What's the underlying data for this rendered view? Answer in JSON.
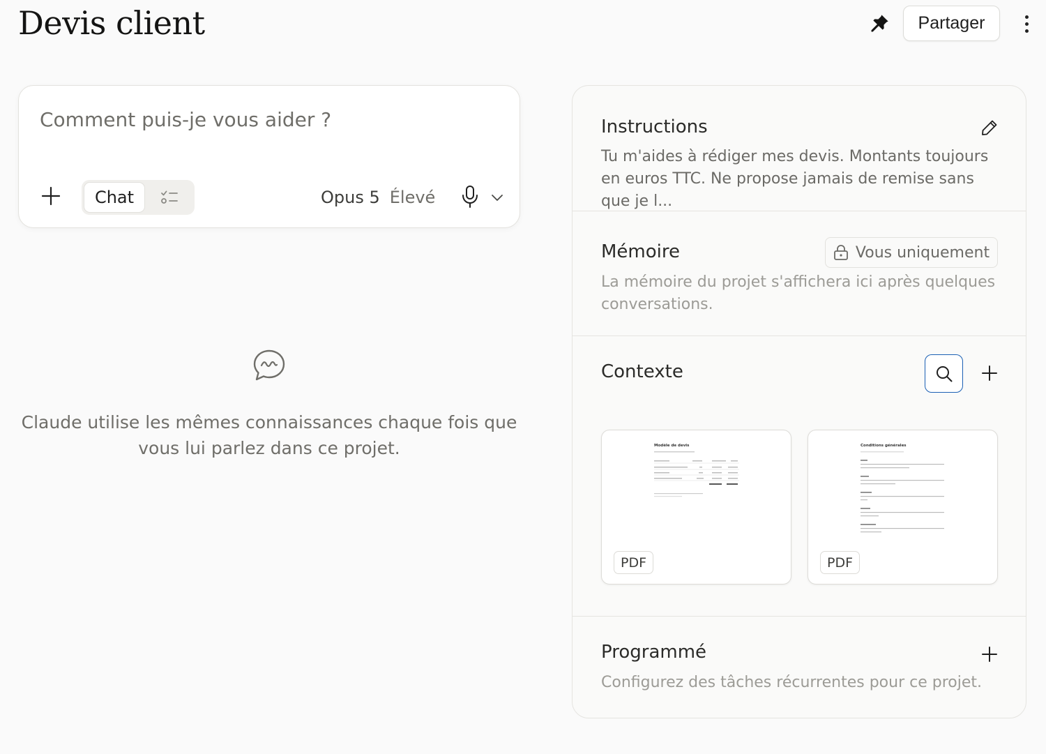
{
  "header": {
    "title": "Devis client",
    "share_label": "Partager"
  },
  "composer": {
    "placeholder": "Comment puis-je vous aider ?",
    "mode_chat_label": "Chat",
    "model_name": "Opus 5",
    "model_effort": "Élevé"
  },
  "empty_state": {
    "text": "Claude utilise les mêmes connaissances chaque fois que vous lui parlez dans ce projet."
  },
  "panel": {
    "instructions": {
      "title": "Instructions",
      "text": "Tu m'aides à rédiger mes devis. Montants toujours en euros TTC. Ne propose jamais de remise sans que je l..."
    },
    "memory": {
      "title": "Mémoire",
      "badge": "Vous uniquement",
      "text": "La mémoire du projet s'affichera ici après quelques conversations."
    },
    "context": {
      "title": "Contexte",
      "files": [
        {
          "type": "PDF",
          "doc_title": "Modèle de devis"
        },
        {
          "type": "PDF",
          "doc_title": "Conditions générales"
        }
      ]
    },
    "scheduled": {
      "title": "Programmé",
      "text": "Configurez des tâches récurrentes pour ce projet."
    }
  },
  "colors": {
    "accent_focus": "#1a5fb4",
    "text_muted": "#6f6e69",
    "background": "#fafafa"
  },
  "icons": [
    "pin-icon",
    "more-vertical-icon",
    "plus-icon",
    "tasks-icon",
    "microphone-icon",
    "chevron-down-icon",
    "chat-bubble-icon",
    "pencil-icon",
    "lock-icon",
    "search-icon"
  ]
}
